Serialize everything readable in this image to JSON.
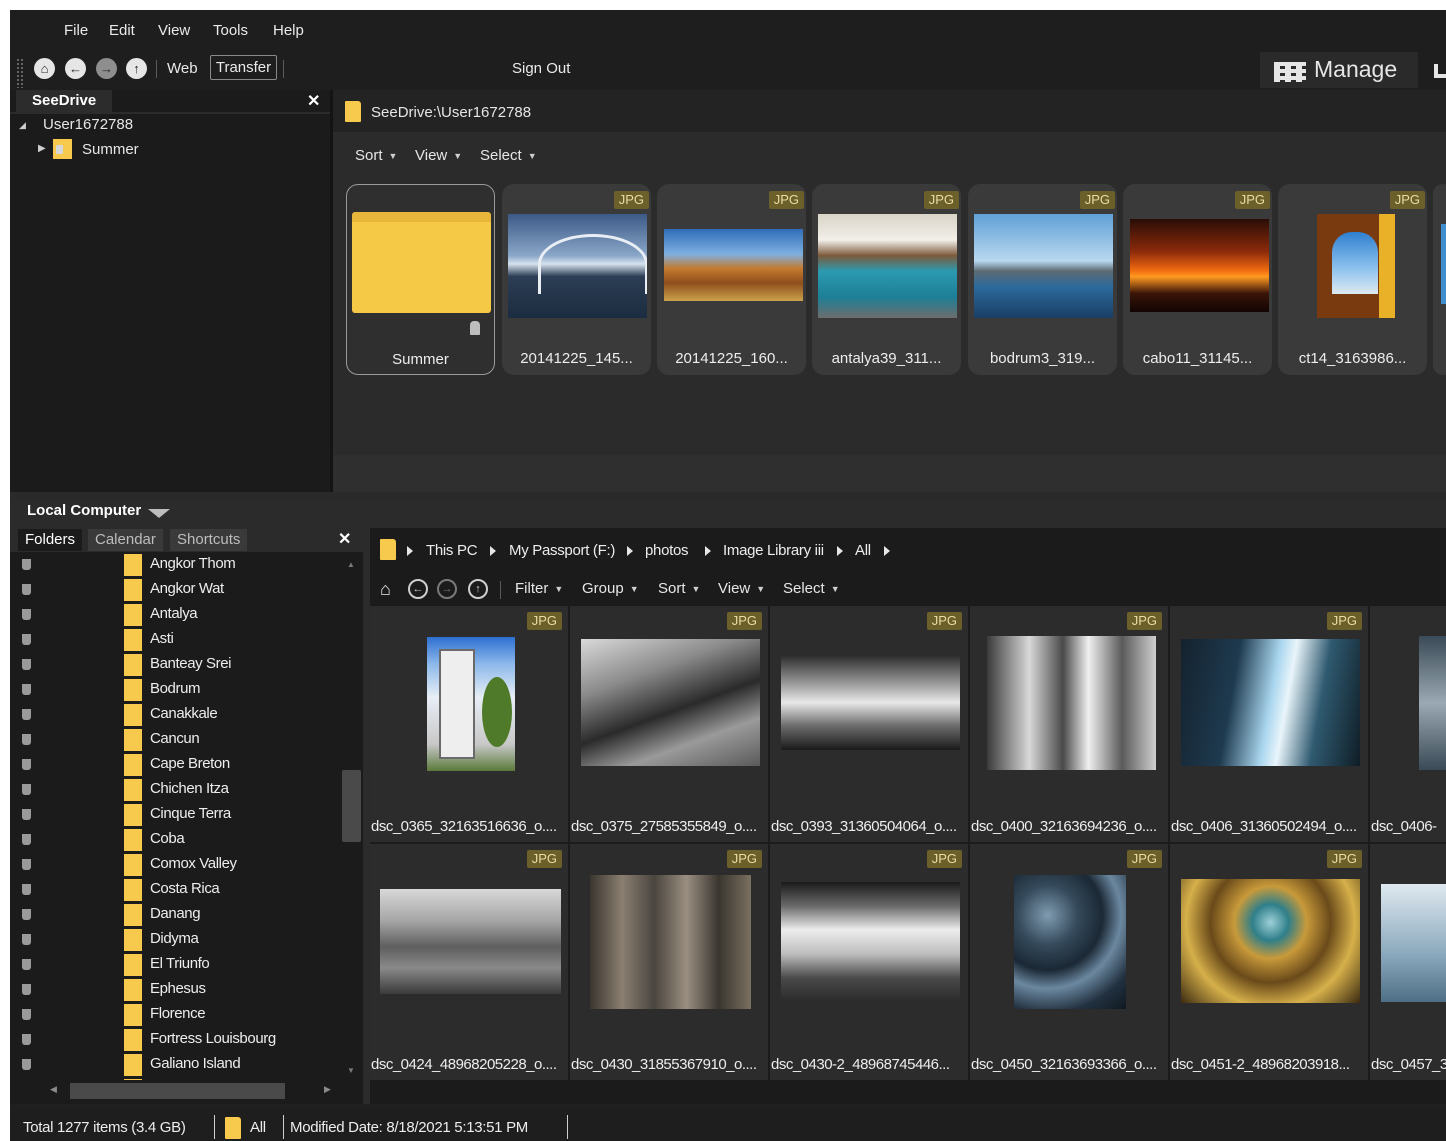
{
  "menu": {
    "file": "File",
    "edit": "Edit",
    "view": "View",
    "tools": "Tools",
    "help": "Help"
  },
  "nav": {
    "web": "Web",
    "transfer": "Transfer",
    "sign_out": "Sign Out",
    "manage": "Manage"
  },
  "seedrive": {
    "tab": "SeeDrive",
    "root": "User1672788",
    "child": "Summer",
    "path": "SeeDrive:\\User1672788",
    "options": {
      "sort": "Sort",
      "view": "View",
      "select": "Select"
    },
    "items": [
      {
        "name": "Summer",
        "type": "folder",
        "badge": ""
      },
      {
        "name": "20141225_145...",
        "type": "image",
        "badge": "JPG"
      },
      {
        "name": "20141225_160...",
        "type": "image",
        "badge": "JPG"
      },
      {
        "name": "antalya39_311...",
        "type": "image",
        "badge": "JPG"
      },
      {
        "name": "bodrum3_319...",
        "type": "image",
        "badge": "JPG"
      },
      {
        "name": "cabo11_31145...",
        "type": "image",
        "badge": "JPG"
      },
      {
        "name": "ct14_3163986...",
        "type": "image",
        "badge": "JPG"
      }
    ]
  },
  "local": {
    "title": "Local Computer",
    "tabs": {
      "folders": "Folders",
      "calendar": "Calendar",
      "shortcuts": "Shortcuts"
    },
    "folders": [
      "Angkor Thom",
      "Angkor Wat",
      "Antalya",
      "Asti",
      "Banteay Srei",
      "Bodrum",
      "Canakkale",
      "Cancun",
      "Cape Breton",
      "Chichen Itza",
      "Cinque Terra",
      "Coba",
      "Comox Valley",
      "Costa Rica",
      "Danang",
      "Didyma",
      "El Triunfo",
      "Ephesus",
      "Florence",
      "Fortress Louisbourg",
      "Galiano Island"
    ],
    "breadcrumb": {
      "pc": "This PC",
      "drive": "My Passport (F:)",
      "photos": "photos",
      "library": "Image Library iii",
      "all": "All"
    },
    "options": {
      "filter": "Filter",
      "group": "Group",
      "sort": "Sort",
      "view": "View",
      "select": "Select"
    },
    "badge": "JPG",
    "row1": [
      "dsc_0365_32163516636_o....",
      "dsc_0375_27585355849_o....",
      "dsc_0393_31360504064_o....",
      "dsc_0400_32163694236_o....",
      "dsc_0406_31360502494_o....",
      "dsc_0406-"
    ],
    "row2": [
      "dsc_0424_48968205228_o....",
      "dsc_0430_31855367910_o....",
      "dsc_0430-2_48968745446...",
      "dsc_0450_32163693366_o....",
      "dsc_0451-2_48968203918...",
      "dsc_0457_3"
    ]
  },
  "status": {
    "total": "Total 1277 items  (3.4 GB)",
    "filter": "All",
    "modified": "Modified Date: 8/18/2021 5:13:51 PM"
  }
}
